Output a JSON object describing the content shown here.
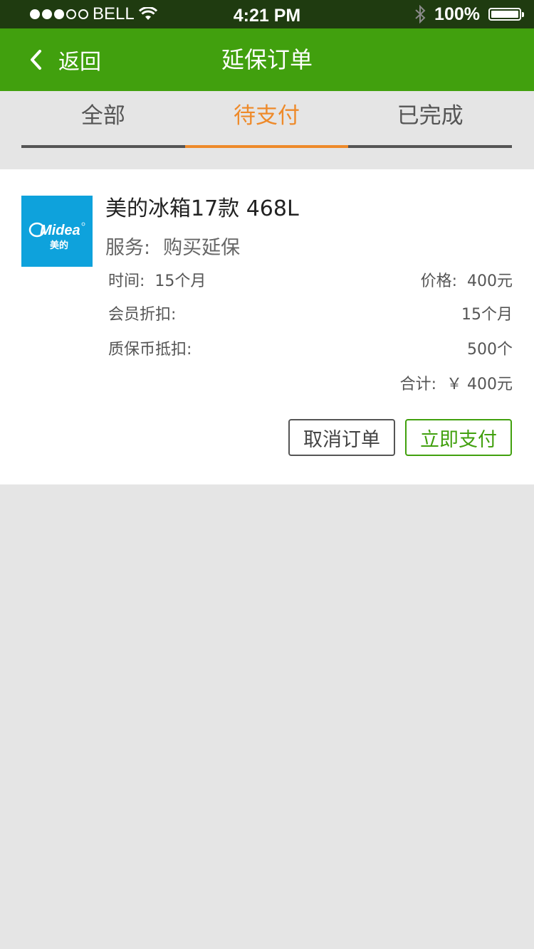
{
  "status_bar": {
    "carrier": "BELL",
    "time": "4:21 PM",
    "battery": "100%"
  },
  "nav": {
    "back_label": "返回",
    "title": "延保订单"
  },
  "tabs": [
    {
      "label": "全部",
      "active": false
    },
    {
      "label": "待支付",
      "active": true
    },
    {
      "label": "已完成",
      "active": false
    }
  ],
  "order": {
    "brand_logo_text": "Midea",
    "brand_logo_subtext": "美的",
    "product_name": "美的冰箱17款 468L",
    "service_label": "服务:",
    "service_value": "购买延保",
    "time_label": "时间:",
    "time_value": "15个月",
    "price_label": "价格:",
    "price_value": "400元",
    "member_discount_label": "会员折扣:",
    "member_discount_value": "15个月",
    "coin_discount_label": "质保币抵扣:",
    "coin_discount_value": "500个",
    "total_label": "合计:",
    "total_value": "￥ 400元",
    "cancel_label": "取消订单",
    "pay_label": "立即支付"
  },
  "colors": {
    "nav_green": "#41a00e",
    "tab_active_orange": "#ee8a2a",
    "midea_blue": "#0ea2dc"
  }
}
